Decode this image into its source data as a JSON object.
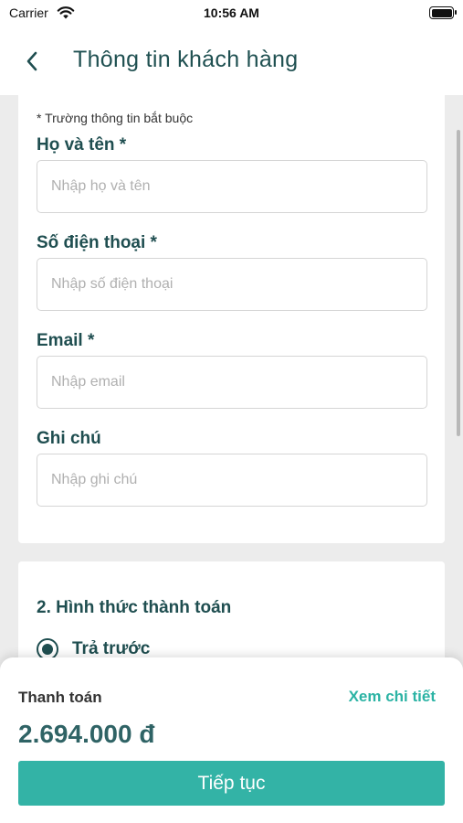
{
  "status_bar": {
    "carrier": "Carrier",
    "time": "10:56 AM"
  },
  "nav": {
    "back_icon": "chevron-left-icon",
    "title": "Thông tin khách hàng"
  },
  "form": {
    "required_note": "* Trường thông tin bắt buộc",
    "fields": [
      {
        "label": "Họ và tên *",
        "placeholder": "Nhập họ và tên",
        "value": ""
      },
      {
        "label": "Số điện thoại *",
        "placeholder": "Nhập số điện thoại",
        "value": ""
      },
      {
        "label": "Email *",
        "placeholder": "Nhập email",
        "value": ""
      },
      {
        "label": "Ghi chú",
        "placeholder": "Nhập ghi chú",
        "value": ""
      }
    ]
  },
  "payment": {
    "section_title": "2. Hình thức thành toán",
    "options": [
      {
        "label": "Trả trước",
        "selected": true
      }
    ]
  },
  "summary": {
    "label": "Thanh toán",
    "detail_link": "Xem chi tiết",
    "total": "2.694.000 đ",
    "button": "Tiếp tục"
  },
  "colors": {
    "primary": "#33b3a6",
    "heading": "#1f4e50",
    "total": "#2f6365",
    "link": "#2bb3a4",
    "background": "#ececec"
  }
}
